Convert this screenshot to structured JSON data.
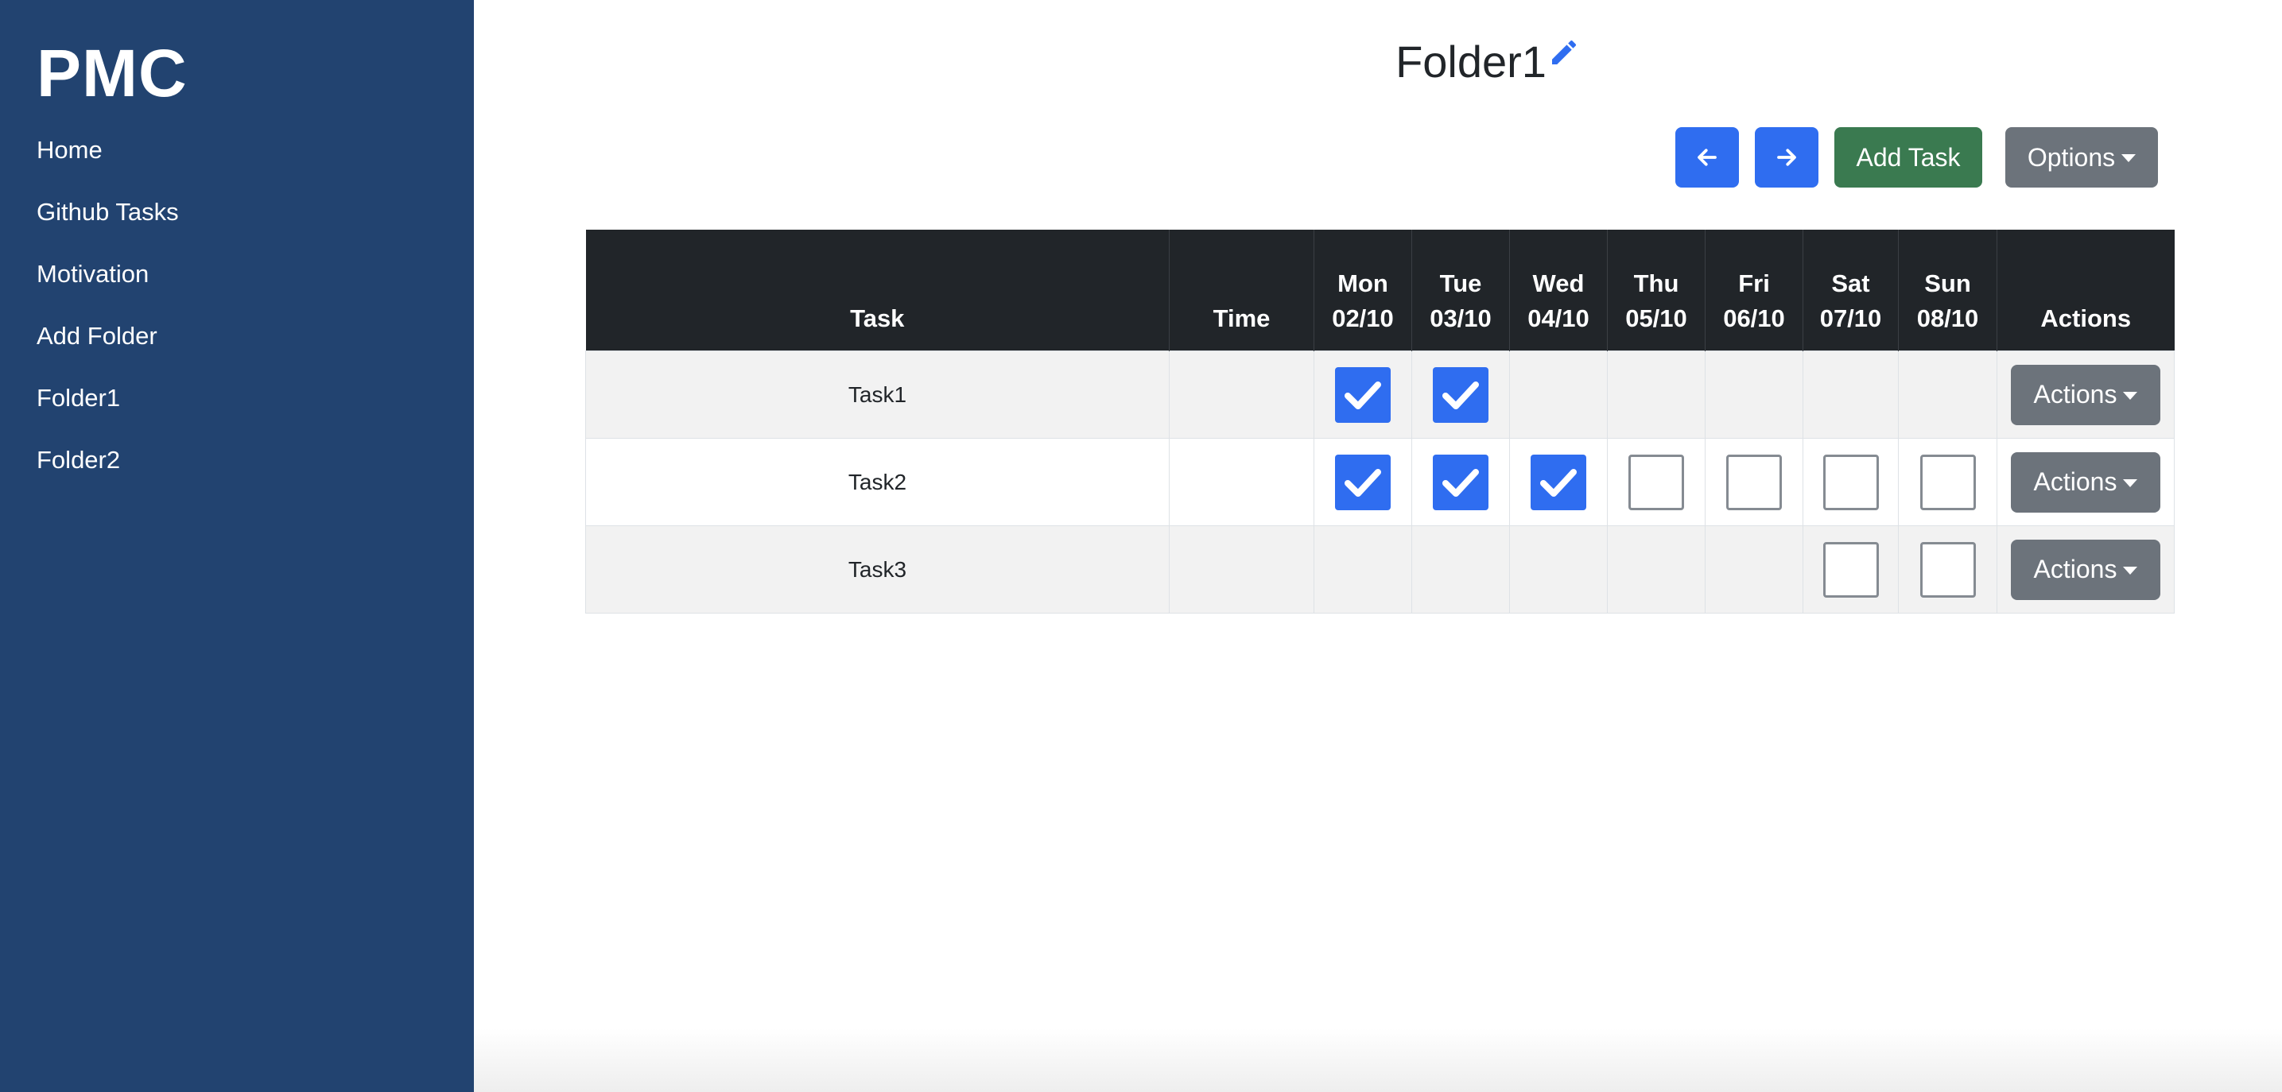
{
  "sidebar": {
    "brand": "PMC",
    "items": [
      {
        "label": "Home"
      },
      {
        "label": "Github Tasks"
      },
      {
        "label": "Motivation"
      },
      {
        "label": "Add Folder"
      },
      {
        "label": "Folder1"
      },
      {
        "label": "Folder2"
      }
    ]
  },
  "header": {
    "title": "Folder1",
    "edit_icon": "pencil-icon"
  },
  "toolbar": {
    "prev_icon": "arrow-left-icon",
    "next_icon": "arrow-right-icon",
    "add_task_label": "Add Task",
    "options_label": "Options"
  },
  "colors": {
    "sidebar": "#224370",
    "primary": "#2f6df0",
    "success": "#3a7a50",
    "secondary": "#6c737b",
    "table_header": "#212529"
  },
  "table": {
    "headers": {
      "task": "Task",
      "time": "Time",
      "actions": "Actions"
    },
    "days": [
      {
        "name": "Mon",
        "date": "02/10"
      },
      {
        "name": "Tue",
        "date": "03/10"
      },
      {
        "name": "Wed",
        "date": "04/10"
      },
      {
        "name": "Thu",
        "date": "05/10"
      },
      {
        "name": "Fri",
        "date": "06/10"
      },
      {
        "name": "Sat",
        "date": "07/10"
      },
      {
        "name": "Sun",
        "date": "08/10"
      }
    ],
    "rows": [
      {
        "task": "Task1",
        "time": "",
        "days": [
          "checked",
          "checked",
          "none",
          "none",
          "none",
          "none",
          "none"
        ],
        "action_label": "Actions"
      },
      {
        "task": "Task2",
        "time": "",
        "days": [
          "checked",
          "checked",
          "checked",
          "unchecked",
          "unchecked",
          "unchecked",
          "unchecked"
        ],
        "action_label": "Actions"
      },
      {
        "task": "Task3",
        "time": "",
        "days": [
          "none",
          "none",
          "none",
          "none",
          "none",
          "unchecked",
          "unchecked"
        ],
        "action_label": "Actions"
      }
    ]
  }
}
